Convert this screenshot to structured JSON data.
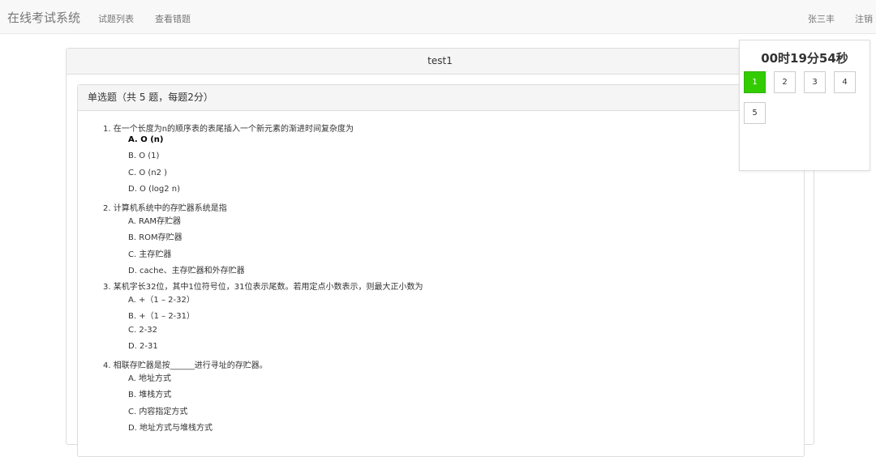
{
  "navbar": {
    "brand": "在线考试系统",
    "links": [
      "试题列表",
      "查看错题"
    ],
    "user": "张三丰",
    "logout": "注销"
  },
  "exam": {
    "title": "test1",
    "section_title": "单选题（共 5 题，每题2分）",
    "questions": [
      {
        "text": "1. 在一个长度为n的顺序表的表尾插入一个新元素的渐进时间复杂度为",
        "options": [
          "A. O (n)",
          "B. O (1)",
          "C. O (n2 )",
          "D. O (log2 n)"
        ],
        "selected": 0
      },
      {
        "text": "2. 计算机系统中的存贮器系统是指",
        "options": [
          "A. RAM存贮器",
          "B. ROM存贮器",
          "C. 主存贮器",
          "D. cache、主存贮器和外存贮器"
        ]
      },
      {
        "text": "3. 某机字长32位，其中1位符号位，31位表示尾数。若用定点小数表示，则最大正小数为",
        "options": [
          "A. +（1 – 2-32）",
          "B. +（1 – 2-31）",
          "C. 2-32",
          "D. 2-31"
        ]
      },
      {
        "text": "4. 相联存贮器是按______进行寻址的存贮器。",
        "options": [
          "A. 地址方式",
          "B. 堆栈方式",
          "C. 内容指定方式",
          "D. 地址方式与堆栈方式"
        ]
      }
    ]
  },
  "timer": {
    "text": "00时19分54秒",
    "buttons": [
      "1",
      "2",
      "3",
      "4",
      "5"
    ],
    "active_color": "#33cc00"
  }
}
